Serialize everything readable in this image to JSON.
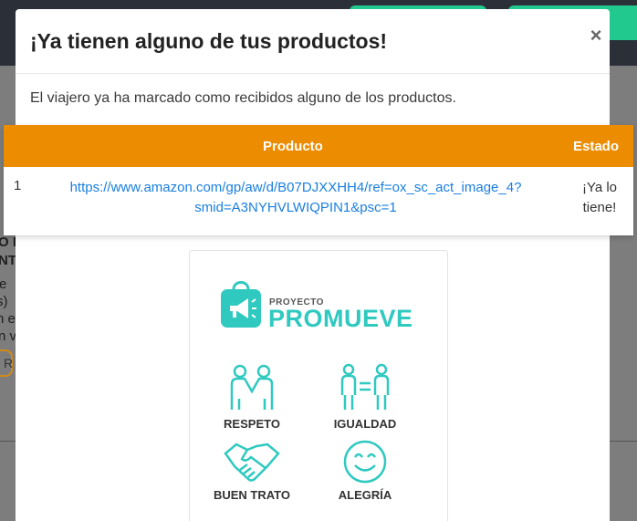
{
  "background": {
    "fragments": [
      "O D",
      "NTC",
      "e",
      "s)",
      "n el",
      "n vi",
      "R"
    ]
  },
  "modal": {
    "title": "¡Ya tienen alguno de tus productos!",
    "close_label": "×",
    "message": "El viajero ya ha marcado como recibidos alguno de los productos."
  },
  "table": {
    "headers": {
      "product": "Producto",
      "status": "Estado"
    },
    "rows": [
      {
        "index": "1",
        "link_line1": "https://www.amazon.com/gp/aw/d/B07DJXXHH4/ref=ox_sc_act_image_4?",
        "link_line2": "smid=A3NYHVLWIQPIN1&psc=1",
        "status_line1": "¡Ya lo",
        "status_line2": "tiene!"
      }
    ]
  },
  "promo": {
    "brand_small": "PROYECTO",
    "brand_big": "PROMUEVE",
    "values": [
      "RESPETO",
      "IGUALDAD",
      "BUEN TRATO",
      "ALEGRÍA"
    ],
    "accent_color": "#2fc9c0"
  },
  "colors": {
    "table_header": "#ec8c00",
    "link": "#1a7fe0",
    "topbar_button": "#22c98e"
  }
}
